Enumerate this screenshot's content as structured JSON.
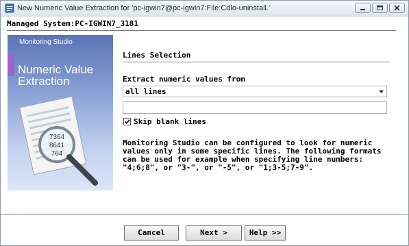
{
  "window": {
    "title": "New Numeric Value Extraction for 'pc-igwin7@pc-igwin7:File:Cdlo-uninstall.'",
    "icon": "app-icon",
    "controls": [
      "minimize-icon",
      "maximize-icon",
      "close-icon"
    ]
  },
  "header": {
    "managed_system": "Managed System:PC-IGWIN7_3181"
  },
  "banner": {
    "brand": "Monitoring Studio",
    "headline_line1": "Numeric Value",
    "headline_line2": "Extraction",
    "paper_numbers": [
      "7364",
      "8641",
      "764"
    ],
    "colors": {
      "top": "#5b74b6",
      "bottom": "#dde6f7",
      "stripe": "#9b64c8"
    }
  },
  "form": {
    "section_title": "Lines Selection",
    "extract_label": "Extract numeric values from",
    "extract_selected": "all lines",
    "line_numbers_value": "",
    "skip_blank": {
      "label": "Skip blank lines",
      "checked": true
    },
    "description": "Monitoring Studio can be configured to look for numeric\nvalues only in some specific lines. The following formats\ncan be used for example when specifying line numbers:\n\"4;6;8\", or \"3-\", or \"-5\", or \"1;3-5;7-9\"."
  },
  "buttons": {
    "cancel": "Cancel",
    "next": "Next >",
    "help": "Help >>"
  }
}
